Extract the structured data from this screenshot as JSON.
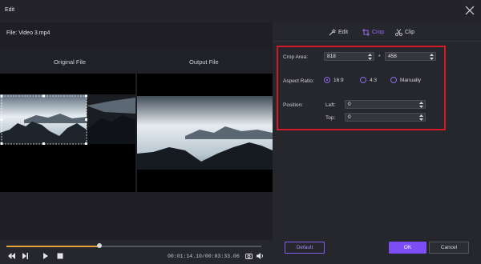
{
  "window": {
    "title": "Edit"
  },
  "file": {
    "label": "File:",
    "name": "Video 3.mp4"
  },
  "preview": {
    "original_label": "Original File",
    "output_label": "Output File"
  },
  "playback": {
    "time": "00:01:14.10/00:03:33.06",
    "progress": 0.365
  },
  "tabs": [
    {
      "label": "Edit",
      "icon": "magic-wand-icon",
      "active": false
    },
    {
      "label": "Crop",
      "icon": "crop-icon",
      "active": true
    },
    {
      "label": "Clip",
      "icon": "scissors-icon",
      "active": false
    }
  ],
  "crop": {
    "area_label": "Crop Area:",
    "width": "818",
    "height": "458",
    "separator": "*",
    "aspect_label": "Aspect Ratio:",
    "aspect_options": [
      {
        "label": "16:9",
        "selected": true
      },
      {
        "label": "4:3",
        "selected": false
      },
      {
        "label": "Manually",
        "selected": false
      }
    ],
    "position_label": "Position:",
    "left_label": "Left:",
    "left_value": "0",
    "top_label": "Top:",
    "top_value": "0"
  },
  "buttons": {
    "default": "Default",
    "ok": "OK",
    "cancel": "Cancel"
  },
  "colors": {
    "accent": "#7c4df5",
    "highlight_box": "#d11a26",
    "progress": "#e8a23a"
  }
}
